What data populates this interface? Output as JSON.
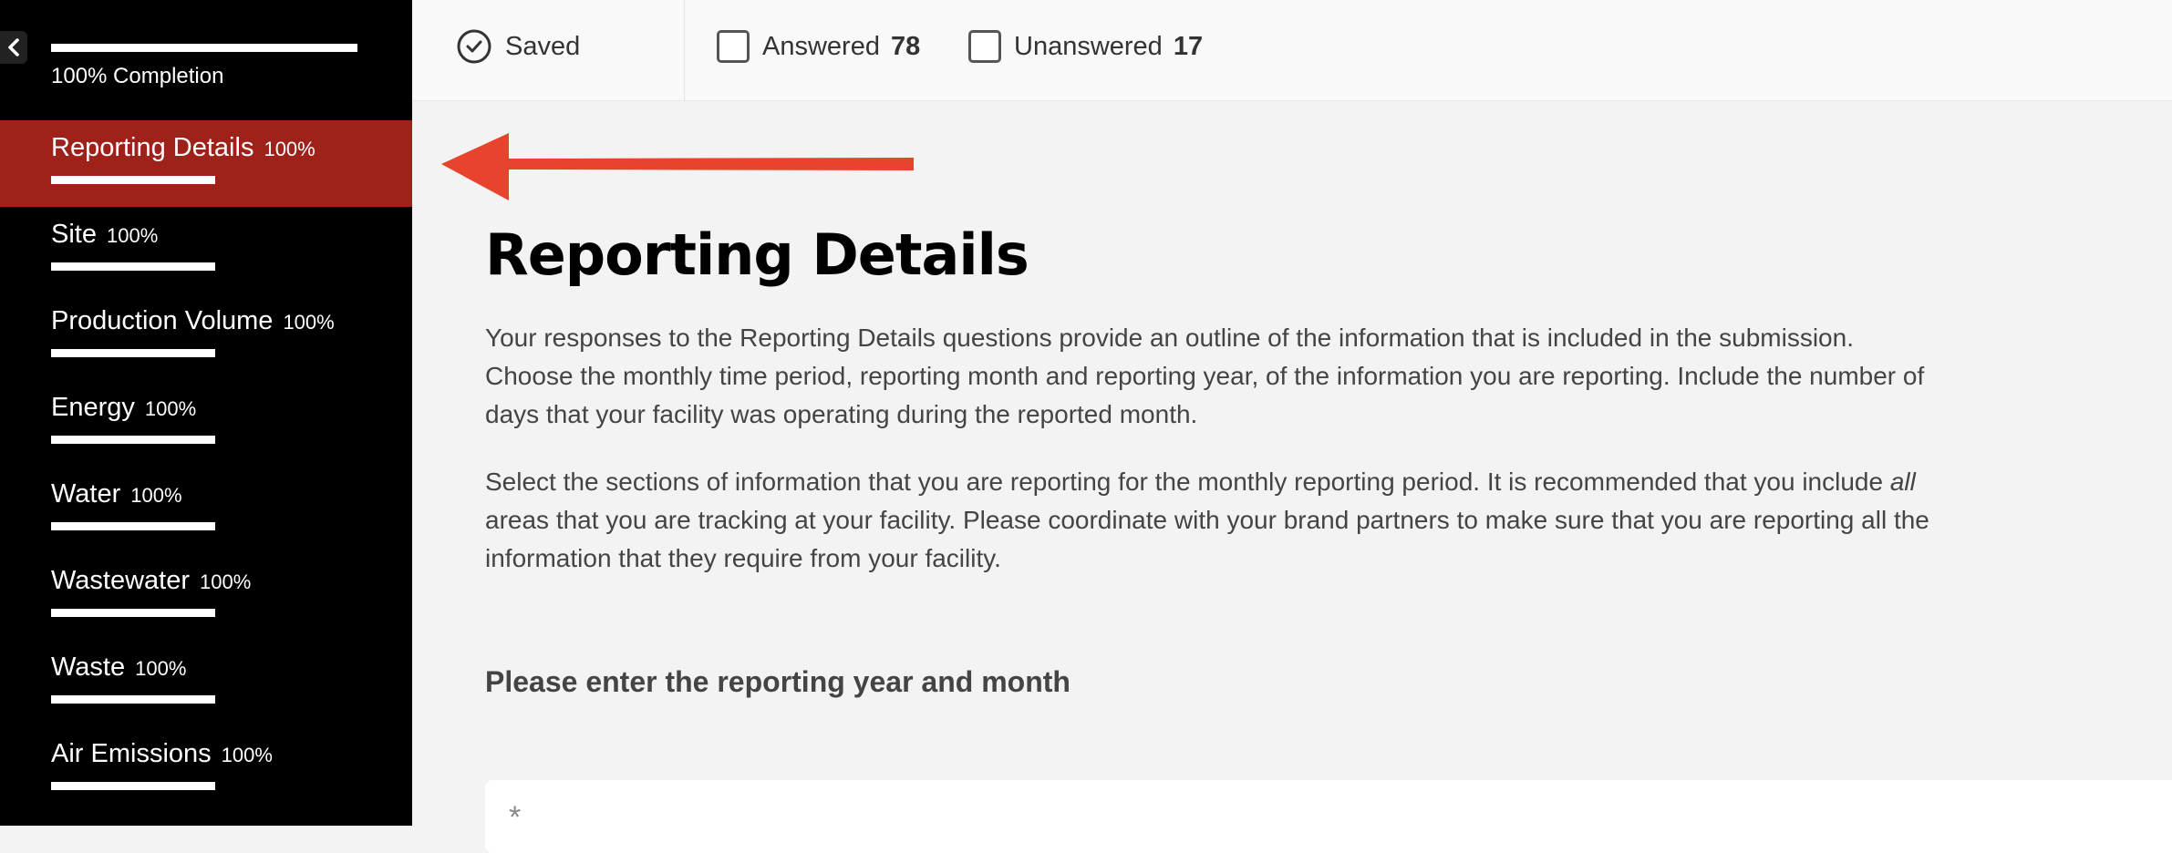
{
  "sidebar": {
    "collapse_icon": "chevron-left-icon",
    "overall_progress": 1.0,
    "completion_label": "100% Completion",
    "active_index": 0,
    "items": [
      {
        "label": "Reporting Details",
        "percent": "100%",
        "progress": 1.0
      },
      {
        "label": "Site",
        "percent": "100%",
        "progress": 1.0
      },
      {
        "label": "Production Volume",
        "percent": "100%",
        "progress": 1.0
      },
      {
        "label": "Energy",
        "percent": "100%",
        "progress": 1.0
      },
      {
        "label": "Water",
        "percent": "100%",
        "progress": 1.0
      },
      {
        "label": "Wastewater",
        "percent": "100%",
        "progress": 1.0
      },
      {
        "label": "Waste",
        "percent": "100%",
        "progress": 1.0
      },
      {
        "label": "Air Emissions",
        "percent": "100%",
        "progress": 1.0
      }
    ]
  },
  "status": {
    "saved_label": "Saved",
    "saved_icon": "check-circle-icon",
    "answered_label": "Answered",
    "answered_count": "78",
    "unanswered_label": "Unanswered",
    "unanswered_count": "17"
  },
  "main": {
    "title": "Reporting Details",
    "para1": "Your responses to the Reporting Details questions provide an outline of the information that is included in the submission. Choose the monthly time period, reporting month and reporting year, of the information you are reporting. Include the number of days that your facility was operating during the reported month.",
    "para2_before": "Select the sections of information that you are reporting for the monthly reporting period. It is recommended that you include ",
    "para2_em": "all",
    "para2_after": " areas that you are tracking at your facility. Please coordinate with your brand partners to make sure that you are reporting all the information that they require from your facility.",
    "question": "Please enter the reporting year and month",
    "required_marker": "*"
  },
  "annotation": {
    "arrow_icon": "arrow-left-icon",
    "color": "#e8432d"
  },
  "colors": {
    "sidebar_bg": "#000000",
    "active_bg": "#9e211a",
    "page_bg": "#f3f3f3"
  }
}
